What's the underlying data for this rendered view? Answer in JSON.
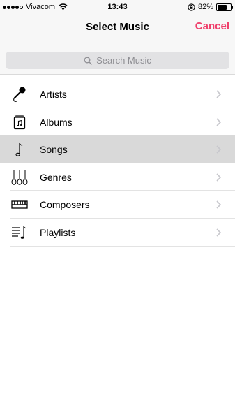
{
  "status_bar": {
    "carrier": "Vivacom",
    "time": "13:43",
    "battery_percent": "82%",
    "battery_level": 0.82,
    "signal_bars_filled": 4,
    "signal_bars_total": 5
  },
  "nav": {
    "title": "Select Music",
    "cancel_label": "Cancel",
    "accent_color": "#ef3f6b"
  },
  "search": {
    "placeholder": "Search Music"
  },
  "menu": {
    "items": [
      {
        "label": "Artists",
        "icon": "microphone-icon",
        "selected": false
      },
      {
        "label": "Albums",
        "icon": "album-icon",
        "selected": false
      },
      {
        "label": "Songs",
        "icon": "music-note-icon",
        "selected": true
      },
      {
        "label": "Genres",
        "icon": "guitars-icon",
        "selected": false
      },
      {
        "label": "Composers",
        "icon": "piano-keyboard-icon",
        "selected": false
      },
      {
        "label": "Playlists",
        "icon": "playlist-icon",
        "selected": false
      }
    ]
  }
}
